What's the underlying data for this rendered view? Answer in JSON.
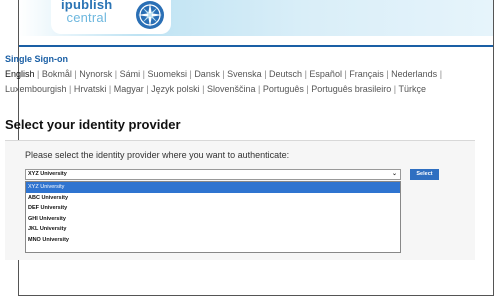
{
  "logo": {
    "line1": "ipublish",
    "line2": "central"
  },
  "sso": {
    "title": "Single Sign-on"
  },
  "languages": {
    "current": "English",
    "others": [
      "Bokmål",
      "Nynorsk",
      "Sámi",
      "Suomeksi",
      "Dansk",
      "Svenska",
      "Deutsch",
      "Español",
      "Français",
      "Nederlands",
      "Luxembourgish",
      "Hrvatski",
      "Magyar",
      "Język polski",
      "Slovenščina",
      "Português",
      "Português brasileiro",
      "Türkçe"
    ]
  },
  "main": {
    "heading": "Select your identity provider",
    "prompt": "Please select the identity provider where you want to authenticate:",
    "selected_value": "XYZ University",
    "select_button": "Select",
    "options": [
      "XYZ University",
      "ABC University",
      "DEF University",
      "GHI University",
      "JKL University",
      "MNO University"
    ],
    "highlighted_index": 0
  },
  "colors": {
    "accent": "#1a5fa5",
    "button": "#2f6fc1",
    "highlight": "#2f74d0"
  }
}
